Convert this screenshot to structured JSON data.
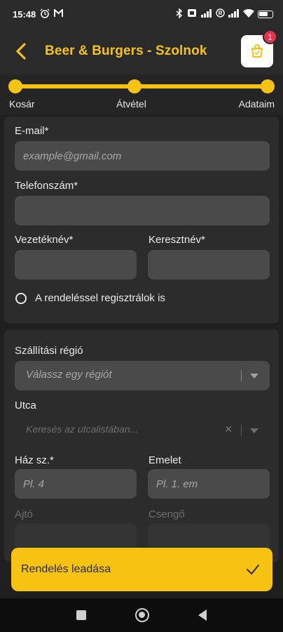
{
  "status_bar": {
    "time": "15:48",
    "left_icons": [
      "alarm-icon",
      "gmail-icon"
    ],
    "right_icons": [
      "bluetooth-icon",
      "vibrate-icon",
      "signal-icon",
      "registered-icon",
      "signal-2-icon",
      "wifi-icon",
      "battery-icon"
    ]
  },
  "header": {
    "title": "Beer & Burgers - Szolnok",
    "cart_count": "1",
    "accent_color": "#f6c312"
  },
  "stepper": {
    "steps": [
      {
        "label": "Kosár"
      },
      {
        "label": "Átvétel"
      },
      {
        "label": "Adataim"
      }
    ]
  },
  "form": {
    "email": {
      "label": "E-mail*",
      "placeholder": "example@gmail.com",
      "value": ""
    },
    "phone": {
      "label": "Telefonszám*",
      "value": ""
    },
    "last_name": {
      "label": "Vezetéknév*",
      "value": ""
    },
    "first_name": {
      "label": "Keresztnév*",
      "value": ""
    },
    "register_checkbox": {
      "label": "A rendeléssel regisztrálok is",
      "checked": false
    },
    "region": {
      "label": "Szállítási régió",
      "placeholder": "Válassz egy régiót"
    },
    "street": {
      "label": "Utca",
      "placeholder": "Keresés az utcalistában...",
      "clear": "×"
    },
    "house_number": {
      "label": "Ház sz.*",
      "placeholder": "Pl. 4"
    },
    "floor": {
      "label": "Emelet",
      "placeholder": "Pl. 1. em"
    },
    "door": {
      "label": "Ajtó"
    },
    "bell": {
      "label": "Csengő"
    }
  },
  "submit": {
    "label": "Rendelés leadása"
  }
}
